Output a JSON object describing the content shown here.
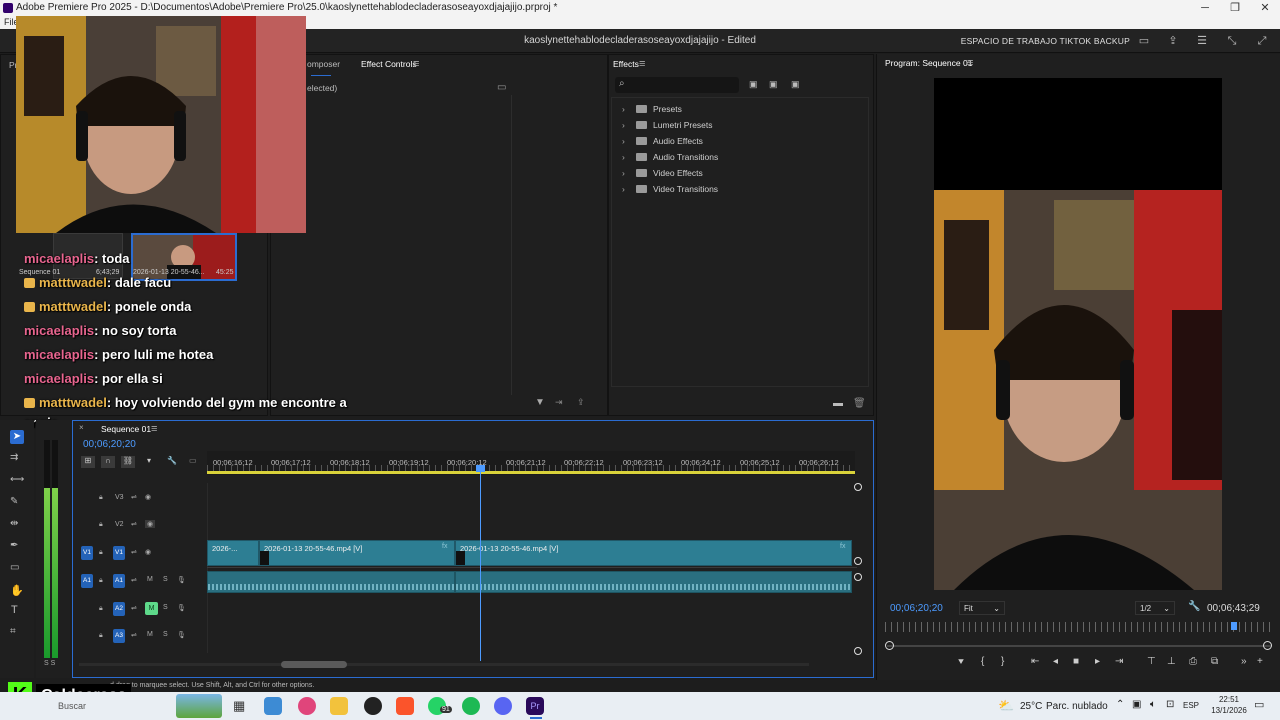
{
  "window": {
    "title": "Adobe Premiere Pro 2025 - D:\\Documentos\\Adobe\\Premiere Pro\\25.0\\kaoslynettehablodecladerasoseayoxdjajajijo.prproj *",
    "menu_first": "File"
  },
  "header": {
    "project": "kaoslynettehablodecladerasoseayoxdjajajijo - Edited",
    "workspace": "ESPACIO DE TRABAJO TIKTOK BACKUP"
  },
  "source_tabs": {
    "composer": "omposer",
    "effect_controls": "Effect Controls",
    "no_selection": "elected)",
    "project_tab": "Pr"
  },
  "effects": {
    "tab": "Effects",
    "items": [
      "Presets",
      "Lumetri Presets",
      "Audio Effects",
      "Audio Transitions",
      "Video Effects",
      "Video Transitions"
    ]
  },
  "bins": {
    "seq_name": "Sequence 01",
    "seq_dur": "6;43;29",
    "clip_name": "2026-01-13 20-55-46...",
    "clip_dur": "45:25"
  },
  "chat": [
    {
      "user": "micaelaplis",
      "msg": ": toda",
      "color": "pink",
      "badge": false
    },
    {
      "user": "matttwadel",
      "msg": ": dale facu",
      "color": "gold",
      "badge": true
    },
    {
      "user": "matttwadel",
      "msg": ": ponele onda",
      "color": "gold",
      "badge": true
    },
    {
      "user": "micaelaplis",
      "msg": ": no soy torta",
      "color": "pink",
      "badge": false
    },
    {
      "user": "micaelaplis",
      "msg": ": pero luli me hotea",
      "color": "pink",
      "badge": false
    },
    {
      "user": "micaelaplis",
      "msg": ": por ella si",
      "color": "pink",
      "badge": false
    },
    {
      "user": "matttwadel",
      "msg": ": hoy volviendo del gym me encontre a",
      "color": "gold",
      "badge": true
    }
  ],
  "chat_wrap": "angie",
  "program": {
    "tab": "Program: Sequence 01",
    "timecode": "00;06;20;20",
    "fit": "Fit",
    "resolution": "1/2",
    "duration": "00;06;43;29",
    "playhead_fraction": 0.9
  },
  "timeline": {
    "tab": "Sequence 01",
    "timecode": "00;06;20;20",
    "ruler": [
      "00;06;16;12",
      "00;06;17;12",
      "00;06;18;12",
      "00;06;19;12",
      "00;06;20;12",
      "00;06;21;12",
      "00;06;22;12",
      "00;06;23;12",
      "00;06;24;12",
      "00;06;25;12",
      "00;06;26;12"
    ],
    "tracks_video": [
      "V3",
      "V2",
      "V1"
    ],
    "tracks_audio": [
      "A1",
      "A2",
      "A3"
    ],
    "mute_label": "M",
    "solo_label": "S",
    "clips": [
      "2026-...",
      "2026-01-13 20-55-46.mp4 [V]",
      "2026-01-13 20-55-46.mp4 [V]"
    ]
  },
  "meters": {
    "labels": "S S"
  },
  "status": {
    "text": "d drag to marquee select. Use Shift, Alt, and Ctrl for other options."
  },
  "overlay": {
    "channel": "Caldeerass",
    "logo_letter": "K"
  },
  "taskbar": {
    "search": "Buscar",
    "weather": "25°C",
    "weather_desc": "Parc. nublado",
    "lang": "ESP",
    "time": "22:51",
    "date": "13/1/2026",
    "whatsapp_badge": "91"
  },
  "colors": {
    "accent": "#2b6cd1",
    "clip_video": "#2d7e93",
    "clip_audio": "#2a6f80",
    "twitch_green": "#53fc18"
  }
}
